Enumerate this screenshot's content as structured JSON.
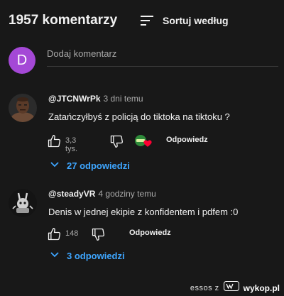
{
  "header": {
    "comment_count": "1957 komentarzy",
    "sort_label": "Sortuj według",
    "sort_icon": "sort-icon"
  },
  "add_comment": {
    "avatar_letter": "D",
    "avatar_color": "#a448d6",
    "placeholder": "Dodaj komentarz"
  },
  "comments": [
    {
      "author": "@JTCNWrPk",
      "time": "3 dni temu",
      "text": "Zatańczyłbyś z policją do tiktoka na tiktoku ?",
      "likes": "3,3 tys.",
      "reply_label": "Odpowiedz",
      "creator_heart": true,
      "replies_label": "27 odpowiedzi"
    },
    {
      "author": "@steadyVR",
      "time": "4 godziny temu",
      "text": "Denis w jednej ekipie z konfidentem i pdfem :0",
      "likes": "148",
      "reply_label": "Odpowiedz",
      "creator_heart": false,
      "replies_label": "3 odpowiedzi"
    }
  ],
  "watermark": {
    "user": "essos z",
    "site": "wykop.pl"
  },
  "colors": {
    "background": "#181818",
    "link": "#3ea6ff",
    "muted": "#aaaaaa",
    "heart": "#ff0033",
    "creator_badge": "#2e8b3a"
  }
}
